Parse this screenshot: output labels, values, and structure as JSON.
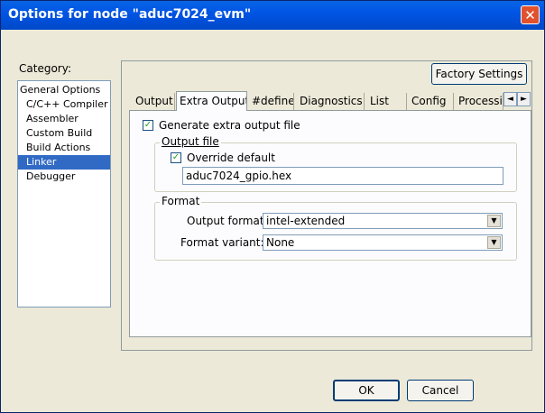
{
  "window": {
    "title": "Options for node \"aduc7024_evm\"",
    "close_glyph": "✕"
  },
  "category": {
    "label": "Category:",
    "items": [
      {
        "label": "General Options",
        "level": 0
      },
      {
        "label": "C/C++ Compiler",
        "level": 1
      },
      {
        "label": "Assembler",
        "level": 1
      },
      {
        "label": "Custom Build",
        "level": 1
      },
      {
        "label": "Build Actions",
        "level": 1
      },
      {
        "label": "Linker",
        "level": 1,
        "selected": true
      },
      {
        "label": "Debugger",
        "level": 1
      }
    ]
  },
  "factory_settings": "Factory Settings",
  "tabs": [
    {
      "label": "Output"
    },
    {
      "label": "Extra Output",
      "active": true
    },
    {
      "label": "#define"
    },
    {
      "label": "Diagnostics"
    },
    {
      "label": "List"
    },
    {
      "label": "Config"
    },
    {
      "label": "Processi"
    }
  ],
  "tab_scroll": {
    "left": "◄",
    "right": "►"
  },
  "generate_extra": {
    "label": "Generate extra output file",
    "checked": true,
    "mark": "✓"
  },
  "output_file_group": {
    "title": "Output file",
    "override": {
      "label": "Override default",
      "checked": true,
      "mark": "✓"
    },
    "filename": "aduc7024_gpio.hex"
  },
  "format_group": {
    "title": "Format",
    "output_format_label": "Output format:",
    "output_format_value": "intel-extended",
    "format_variant_label": "Format variant:",
    "format_variant_value": "None",
    "arrow": "▼"
  },
  "buttons": {
    "ok": "OK",
    "cancel": "Cancel"
  }
}
